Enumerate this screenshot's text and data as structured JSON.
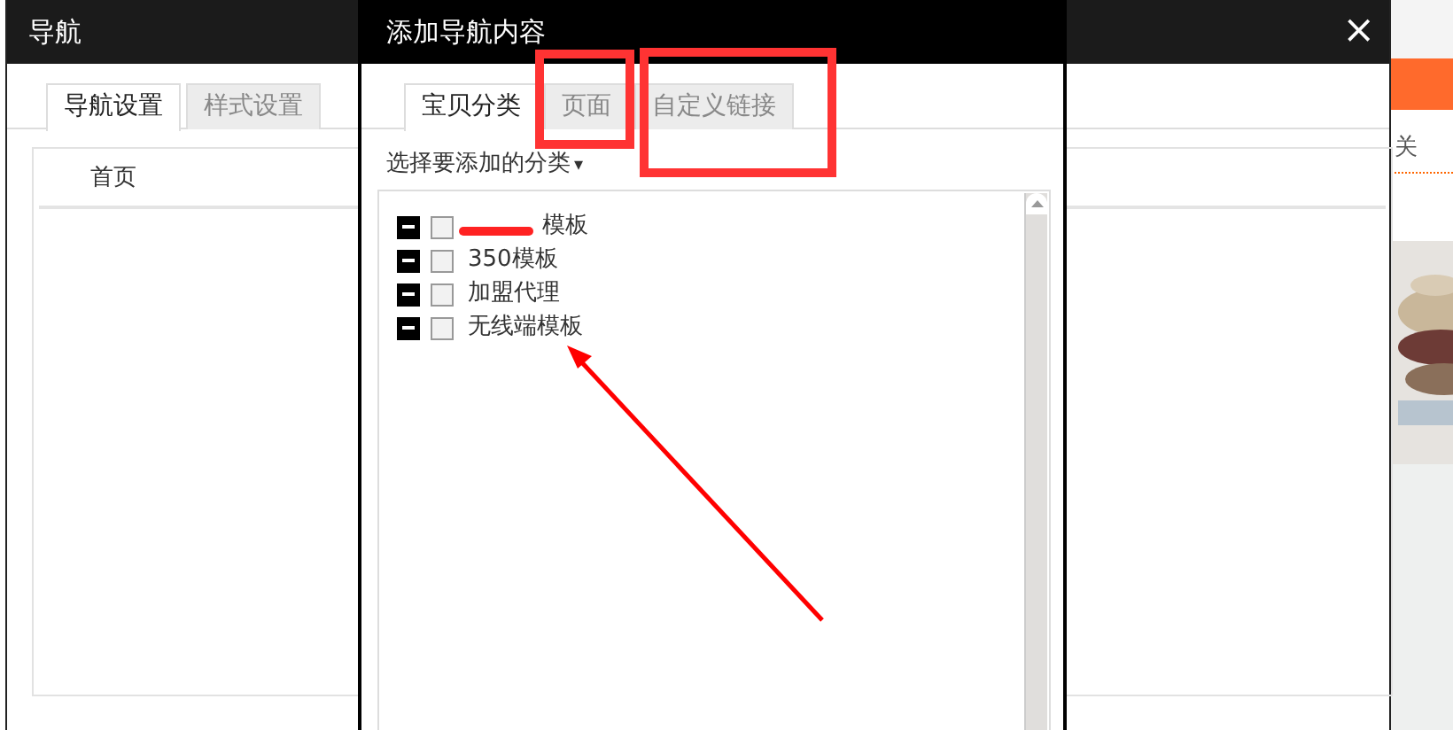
{
  "background_page": {
    "link": "关"
  },
  "back_dialog": {
    "title": "导航",
    "close": "×",
    "tabs": [
      {
        "label": "导航设置",
        "selected": true
      },
      {
        "label": "样式设置",
        "selected": false
      }
    ],
    "list_header": "首页"
  },
  "front_dialog": {
    "title": "添加导航内容",
    "tabs": [
      {
        "label": "宝贝分类",
        "selected": true
      },
      {
        "label": "页面",
        "selected": false
      },
      {
        "label": "自定义链接",
        "selected": false
      }
    ],
    "section_label": "选择要添加的分类",
    "dropdown_arrow": "▾",
    "tree": [
      {
        "label": "模板",
        "expanded": true,
        "checked": false
      },
      {
        "label": "350模板",
        "expanded": true,
        "checked": false
      },
      {
        "label": "加盟代理",
        "expanded": true,
        "checked": false
      },
      {
        "label": "无线端模板",
        "expanded": true,
        "checked": false
      }
    ]
  },
  "annotations": [
    {
      "kind": "box"
    },
    {
      "kind": "box"
    },
    {
      "kind": "arrow"
    },
    {
      "kind": "redaction"
    }
  ]
}
